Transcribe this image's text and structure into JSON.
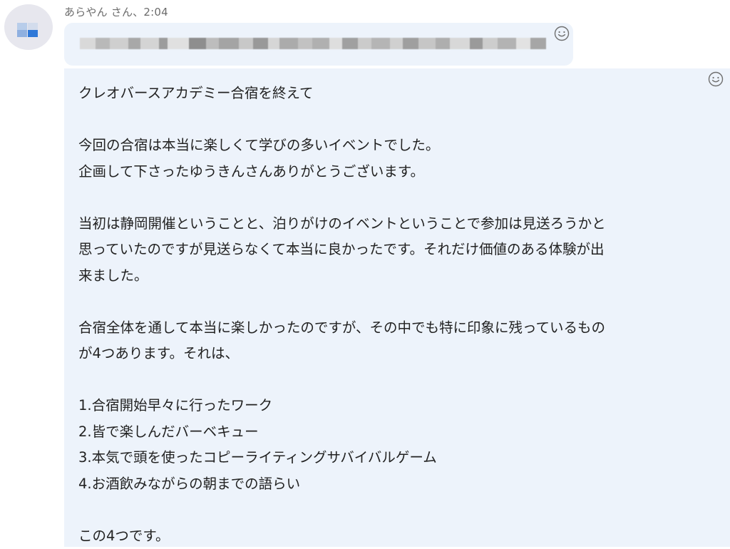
{
  "sender": {
    "name_time": "あらやん さん、2:04"
  },
  "icons": {
    "avatar": "avatar-pixelated",
    "reaction": "smiley-icon"
  },
  "colors": {
    "bubble_bg": "#edf3fb",
    "meta_text": "#6b6b6b",
    "body_text": "#222222"
  },
  "message": {
    "lines": [
      "クレオバースアカデミー合宿を終えて",
      "",
      "今回の合宿は本当に楽しくて学びの多いイベントでした。",
      "企画して下さったゆうきんさんありがとうございます。",
      "",
      "当初は静岡開催ということと、泊りがけのイベントということで参加は見送ろうかと",
      "思っていたのですが見送らなくて本当に良かったです。それだけ価値のある体験が出",
      "来ました。",
      "",
      "合宿全体を通して本当に楽しかったのですが、その中でも特に印象に残っているもの",
      "が4つあります。それは、",
      "",
      "1.合宿開始早々に行ったワーク",
      "2.皆で楽しんだバーベキュー",
      "3.本気で頭を使ったコピーライティングサバイバルゲーム",
      "4.お酒飲みながらの朝までの語らい",
      "",
      "この4つです。"
    ]
  }
}
